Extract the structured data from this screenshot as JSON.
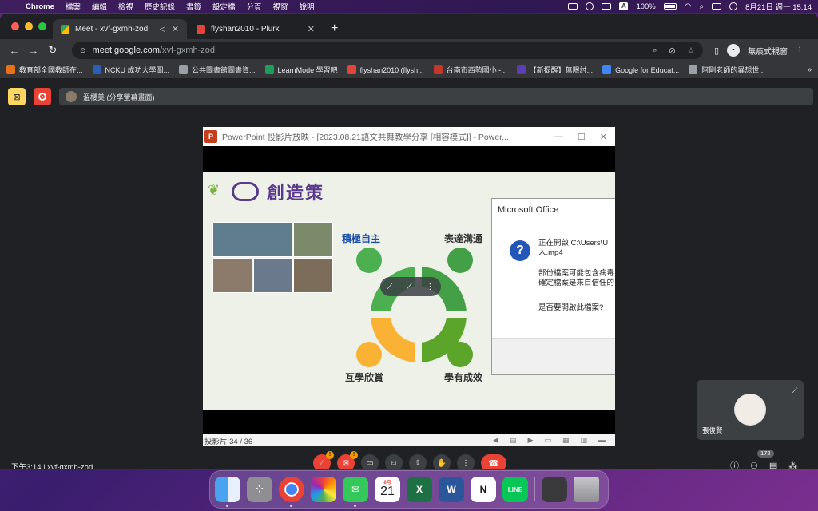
{
  "menubar": {
    "app_name": "Chrome",
    "menus": [
      "檔案",
      "編輯",
      "檢視",
      "歷史記錄",
      "書籤",
      "設定檔",
      "分頁",
      "視窗",
      "說明"
    ],
    "battery": "100%",
    "datetime": "8月21日 週一  15:14",
    "input_letter": "A"
  },
  "tabs": [
    {
      "title": "Meet - xvf-gxmh-zod",
      "active": true
    },
    {
      "title": "flyshan2010 - Plurk",
      "active": false
    }
  ],
  "omnibox": {
    "host": "meet.google.com",
    "path": "/xvf-gxmh-zod"
  },
  "profile_label": "無痕式視窗",
  "bookmarks": [
    {
      "label": "教育部全國教師在...",
      "color": "#e8711a"
    },
    {
      "label": "NCKU 成功大學圖...",
      "color": "#2b5fb3"
    },
    {
      "label": "公共圖書館圖書資...",
      "color": "#9aa0a6"
    },
    {
      "label": "LearnMode 學習吧",
      "color": "#1e9e5a"
    },
    {
      "label": "flyshan2010 (flysh...",
      "color": "#e0443a"
    },
    {
      "label": "台南市西勢國小 -...",
      "color": "#c0392b"
    },
    {
      "label": "【新提醒】無限討...",
      "color": "#5b3fb3"
    },
    {
      "label": "Google for Educat...",
      "color": "#4285f4"
    },
    {
      "label": "阿剛老師的異想世...",
      "color": "#9aa0a6"
    }
  ],
  "meet": {
    "presenter": "溫櫻美 (分享螢幕畫面)",
    "time_code": "下午3:14  |  xvf-gxmh-zod",
    "participant_count": "172",
    "participant_name": "張俊賢"
  },
  "ppt": {
    "window_title": "PowerPoint 投影片放映 - [2023.08.21語文共舞教學分享 [相容模式]] - Power...",
    "slide_status": "投影片 34 / 36",
    "brand": "創造策",
    "labels": [
      "積極自主",
      "表達溝通",
      "互學欣賞",
      "學有成效"
    ]
  },
  "dialog": {
    "title": "Microsoft Office",
    "line1": "正在開啟 C:\\Users\\U\n人.mp4",
    "line2": "部份檔案可能包含病毒\n確定檔案是來自信任的",
    "line3": "是否要開啟此檔案?"
  },
  "dock": {
    "calendar_month": "8月",
    "calendar_day": "21"
  },
  "colors": {
    "meet_bg": "#202124",
    "hangup": "#ea4335",
    "wheel_green": "#4caf50",
    "wheel_orange": "#f9b233"
  }
}
